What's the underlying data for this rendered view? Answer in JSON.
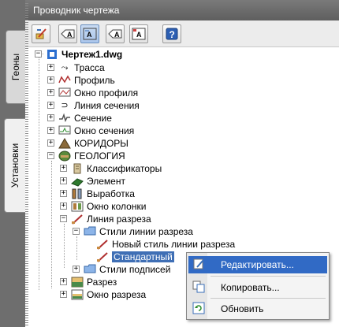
{
  "tabs": [
    {
      "label": "Геоны",
      "active": false
    },
    {
      "label": "Установки",
      "active": true
    }
  ],
  "panel": {
    "title": "Проводник чертежа"
  },
  "toolbar": {
    "buttons": [
      {
        "icon": "edit-drawing-icon",
        "pressed": false
      },
      {
        "icon": "label-style-icon",
        "pressed": false
      },
      {
        "icon": "label-style-active-icon",
        "pressed": true
      },
      {
        "icon": "label-style-arrow-icon",
        "pressed": false
      },
      {
        "icon": "label-style-grid-icon",
        "pressed": false
      },
      {
        "icon": "help-icon",
        "pressed": false
      }
    ]
  },
  "tree": {
    "root": "Чертеж1.dwg",
    "items": [
      {
        "label": "Трасса",
        "icon": "alignment-icon"
      },
      {
        "label": "Профиль",
        "icon": "profile-icon"
      },
      {
        "label": "Окно профиля",
        "icon": "profile-view-icon"
      },
      {
        "label": "Линия сечения",
        "icon": "sample-line-icon"
      },
      {
        "label": "Сечение",
        "icon": "section-icon"
      },
      {
        "label": "Окно сечения",
        "icon": "section-view-icon"
      },
      {
        "label": "КОРИДОРЫ",
        "icon": "corridor-icon"
      },
      {
        "label": "ГЕОЛОГИЯ",
        "icon": "geology-icon"
      },
      {
        "label": "Классификаторы",
        "icon": "classifier-icon"
      },
      {
        "label": "Элемент",
        "icon": "element-icon"
      },
      {
        "label": "Выработка",
        "icon": "borehole-icon"
      },
      {
        "label": "Окно колонки",
        "icon": "column-view-icon"
      },
      {
        "label": "Линия разреза",
        "icon": "cut-line-icon"
      },
      {
        "label": "Стили линии разреза",
        "icon": "folder-icon"
      },
      {
        "label": "Новый стиль линии разреза",
        "icon": "cut-line-style-icon"
      },
      {
        "label": "Стандартный",
        "icon": "cut-line-style-icon"
      },
      {
        "label": "Стили подписей",
        "icon": "folder-icon"
      },
      {
        "label": "Разрез",
        "icon": "cross-section-icon"
      },
      {
        "label": "Окно разреза",
        "icon": "cross-section-view-icon"
      }
    ]
  },
  "context_menu": {
    "items": [
      {
        "label": "Редактировать...",
        "icon": "edit-icon",
        "highlighted": true
      },
      {
        "label": "Копировать...",
        "icon": "copy-icon",
        "highlighted": false
      },
      {
        "label": "Обновить",
        "icon": "refresh-icon",
        "highlighted": false
      }
    ]
  },
  "colors": {
    "selection": "#3f6fb5",
    "menu_highlight": "#316ac5",
    "titlebar": "#6a6a6a"
  }
}
